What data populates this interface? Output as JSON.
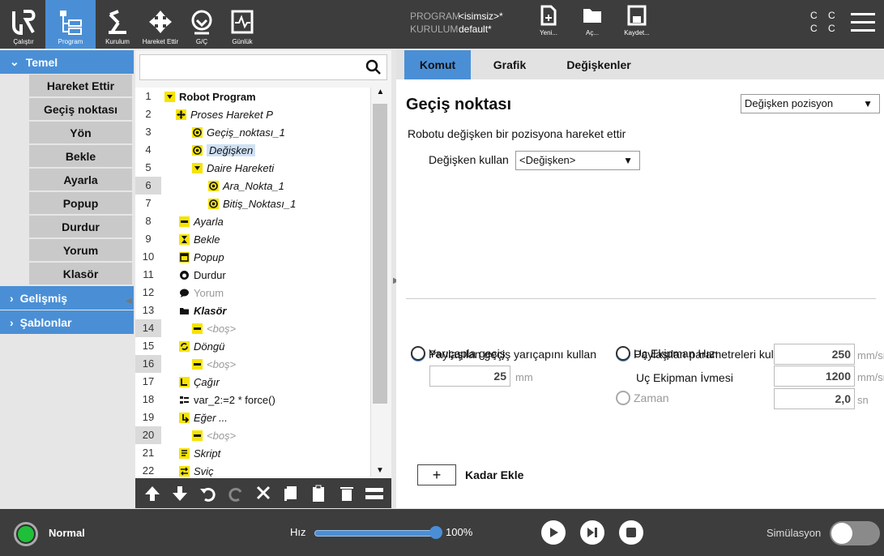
{
  "topbar": {
    "nav": [
      {
        "label": "Çalıştır",
        "icon": "ur-logo-icon"
      },
      {
        "label": "Program",
        "icon": "program-tree-icon",
        "active": true
      },
      {
        "label": "Kurulum",
        "icon": "robot-arm-icon"
      },
      {
        "label": "Hareket Ettir",
        "icon": "move-arrows-icon"
      },
      {
        "label": "G/Ç",
        "icon": "io-icon"
      },
      {
        "label": "Günlük",
        "icon": "log-icon"
      }
    ],
    "program_key": "PROGRAM",
    "program_value": "<isimsiz>*",
    "install_key": "KURULUM",
    "install_value": "default*",
    "file_buttons": [
      {
        "label": "Yeni...",
        "icon": "new-file-icon"
      },
      {
        "label": "Aç...",
        "icon": "open-folder-icon"
      },
      {
        "label": "Kaydet...",
        "icon": "save-icon"
      }
    ],
    "cc_line1": "C C",
    "cc_line2": "C C"
  },
  "left": {
    "temel": "Temel",
    "commands": [
      "Hareket Ettir",
      "Geçiş noktası",
      "Yön",
      "Bekle",
      "Ayarla",
      "Popup",
      "Durdur",
      "Yorum",
      "Klasör"
    ],
    "gelismis": "Gelişmiş",
    "sablonlar": "Şablonlar"
  },
  "tree": {
    "rows": [
      {
        "n": "1",
        "text": "Robot Program",
        "icon": "dropdown-icon"
      },
      {
        "n": "2",
        "text": "Proses Hareket P",
        "icon": "move-icon"
      },
      {
        "n": "3",
        "text": "Geçiş_noktası_1",
        "icon": "waypoint-icon"
      },
      {
        "n": "4",
        "text": "Değişken",
        "icon": "waypoint-icon"
      },
      {
        "n": "5",
        "text": "Daire Hareketi",
        "icon": "dropdown-icon"
      },
      {
        "n": "6",
        "text": "Ara_Nokta_1",
        "icon": "waypoint-icon"
      },
      {
        "n": "7",
        "text": "Bitiş_Noktası_1",
        "icon": "waypoint-icon"
      },
      {
        "n": "8",
        "text": "Ayarla",
        "icon": "set-icon"
      },
      {
        "n": "9",
        "text": "Bekle",
        "icon": "hourglass-icon"
      },
      {
        "n": "10",
        "text": "Popup",
        "icon": "popup-icon"
      },
      {
        "n": "11",
        "text": "Durdur",
        "icon": "stop-hand-icon"
      },
      {
        "n": "12",
        "text": "Yorum",
        "icon": "comment-icon"
      },
      {
        "n": "13",
        "text": "Klasör",
        "icon": "folder-icon"
      },
      {
        "n": "14",
        "text": "<boş>",
        "icon": "set-icon"
      },
      {
        "n": "15",
        "text": "Döngü",
        "icon": "loop-icon"
      },
      {
        "n": "16",
        "text": "<boş>",
        "icon": "set-icon"
      },
      {
        "n": "17",
        "text": "Çağır",
        "icon": "call-icon"
      },
      {
        "n": "18",
        "text": "var_2:=2 * force()",
        "icon": "assignment-icon"
      },
      {
        "n": "19",
        "text": "Eğer ...",
        "icon": "if-icon"
      },
      {
        "n": "20",
        "text": "<boş>",
        "icon": "set-icon"
      },
      {
        "n": "21",
        "text": "Skript",
        "icon": "script-icon"
      },
      {
        "n": "22",
        "text": "Sviç",
        "icon": "switch-icon"
      }
    ]
  },
  "tabs": [
    "Komut",
    "Grafik",
    "Değişkenler"
  ],
  "main": {
    "title": "Geçiş noktası",
    "type_select": "Değişken pozisyon",
    "description": "Robotu değişken bir pozisyona hareket ettir",
    "var_label": "Değişken kullan",
    "var_select": "<Değişken>",
    "r_shared_blend": "Paylaşılan geçiş yarıçapını kullan",
    "r_blend_radius": "Yarıçapla geçiş",
    "blend_value": "25",
    "blend_unit": "mm",
    "r_shared_params": "Paylaşılan parametreleri kullan",
    "r_tool_speed": "Uç Ekipman Hızı",
    "tool_speed_value": "250",
    "tool_speed_unit": "mm/sr",
    "tool_accel_label": "Uç Ekipman İvmesi",
    "tool_accel_value": "1200",
    "tool_accel_unit": "mm/sr",
    "r_time": "Zaman",
    "time_value": "2,0",
    "time_unit": "sn",
    "add_symbol": "+",
    "add_label": "Kadar Ekle"
  },
  "bottom": {
    "status": "Normal",
    "speed_label": "Hız",
    "speed_value": "100%",
    "speed_fraction": 1.0,
    "sim_label": "Simülasyon"
  },
  "colors": {
    "accent": "#4a8fd6",
    "dark": "#3d3d3d",
    "highlight": "#f5e400",
    "ok": "#1fbf3a"
  }
}
